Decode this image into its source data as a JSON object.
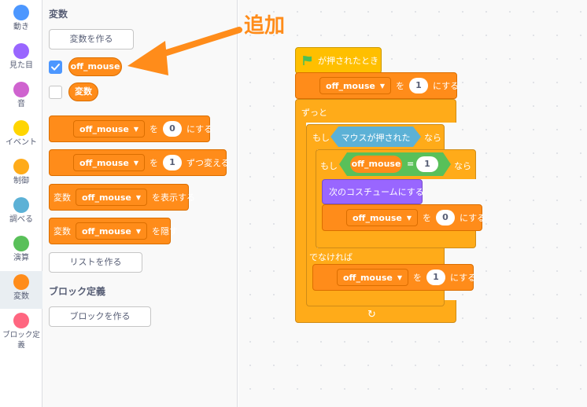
{
  "categories": [
    {
      "label": "動き",
      "color": "#4c97ff"
    },
    {
      "label": "見た目",
      "color": "#9966ff"
    },
    {
      "label": "音",
      "color": "#cf63cf"
    },
    {
      "label": "イベント",
      "color": "#ffd500"
    },
    {
      "label": "制御",
      "color": "#ffab19"
    },
    {
      "label": "調べる",
      "color": "#5cb1d6"
    },
    {
      "label": "演算",
      "color": "#59c059"
    },
    {
      "label": "変数",
      "color": "#ff8c1a"
    },
    {
      "label": "ブロック定義",
      "color": "#ff6680"
    }
  ],
  "palette": {
    "variables_title": "変数",
    "make_variable": "変数を作る",
    "var_off_mouse": "off_mouse",
    "var_hensu": "変数",
    "set_block": {
      "var": "off_mouse",
      "to": "を",
      "value": "0",
      "tail": "にする"
    },
    "change_block": {
      "var": "off_mouse",
      "by": "を",
      "value": "1",
      "tail": "ずつ変える"
    },
    "show_block": {
      "head": "変数",
      "var": "off_mouse",
      "tail": "を表示する"
    },
    "hide_block": {
      "head": "変数",
      "var": "off_mouse",
      "tail": "を隠す"
    },
    "make_list": "リストを作る",
    "my_blocks_title": "ブロック定義",
    "make_block": "ブロックを作る"
  },
  "annotation": {
    "text": "追加",
    "color": "#ff8c1a"
  },
  "script": {
    "hat": "が押されたとき",
    "init_set": {
      "var": "off_mouse",
      "to": "を",
      "value": "1",
      "tail": "にする"
    },
    "forever": "ずっと",
    "if_label": "もし",
    "then_label": "なら",
    "mouse_down": "マウスが押された",
    "inner_if": "もし",
    "inner_then": "なら",
    "eq_var": "off_mouse",
    "eq_op": "=",
    "eq_value": "1",
    "next_costume": "次のコスチュームにする",
    "set_zero": {
      "var": "off_mouse",
      "to": "を",
      "value": "0",
      "tail": "にする"
    },
    "else_label": "でなければ",
    "set_one": {
      "var": "off_mouse",
      "to": "を",
      "value": "1",
      "tail": "にする"
    },
    "loop_arrow": "↻"
  }
}
